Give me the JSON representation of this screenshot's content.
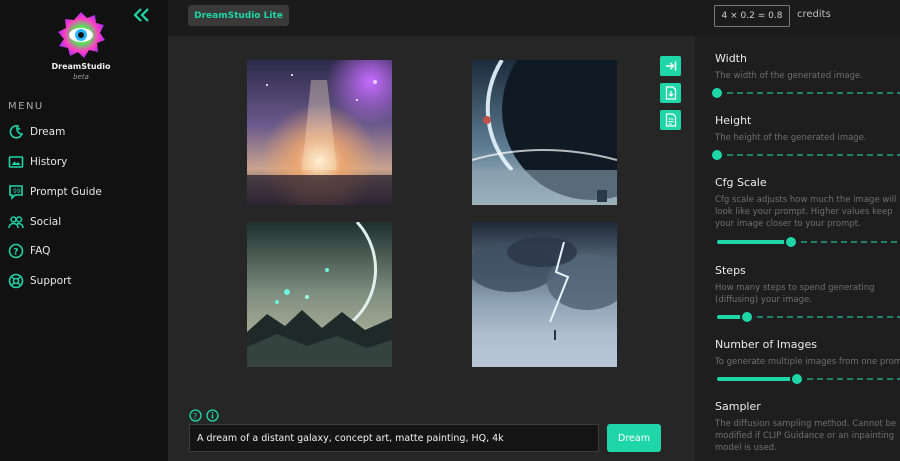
{
  "sidebar": {
    "brand": "DreamStudio",
    "brand_sub": "beta",
    "menu_heading": "MENU",
    "items": [
      {
        "label": "Dream",
        "icon": "dream-icon"
      },
      {
        "label": "History",
        "icon": "history-icon"
      },
      {
        "label": "Prompt Guide",
        "icon": "prompt-guide-icon"
      },
      {
        "label": "Social",
        "icon": "social-icon"
      },
      {
        "label": "FAQ",
        "icon": "faq-icon"
      },
      {
        "label": "Support",
        "icon": "support-icon"
      }
    ]
  },
  "topbar": {
    "version_label": "DreamStudio Lite",
    "credits_formula": "4 × 0.2 = 0.8",
    "credits_label": "credits"
  },
  "prompt": {
    "value": "A dream of a distant galaxy, concept art, matte painting, HQ, 4k",
    "button_label": "Dream"
  },
  "images": [
    {
      "subject": "nebula-light-beam"
    },
    {
      "subject": "planet-horizon"
    },
    {
      "subject": "mountains-planet"
    },
    {
      "subject": "storm-clouds-lightning"
    }
  ],
  "settings": {
    "width": {
      "title": "Width",
      "desc": "The width of the generated image.",
      "level": 0.0
    },
    "height": {
      "title": "Height",
      "desc": "The height of the generated image.",
      "level": 0.0
    },
    "cfg": {
      "title": "Cfg Scale",
      "desc": "Cfg scale adjusts how much the image will look like your prompt. Higher values keep your image closer to your prompt.",
      "level": 0.37
    },
    "steps": {
      "title": "Steps",
      "desc": "How many steps to spend generating (diffusing) your image.",
      "level": 0.15
    },
    "num_images": {
      "title": "Number of Images",
      "desc": "To generate multiple images from one prompt",
      "level": 0.4
    },
    "sampler": {
      "title": "Sampler",
      "desc": "The diffusion sampling method. Cannot be modified if CLIP Guidance or an inpainting model is used."
    }
  },
  "colors": {
    "accent": "#1fd6a8",
    "background": "#262626",
    "sidebar": "#111111",
    "panel": "#1e1e1e"
  }
}
